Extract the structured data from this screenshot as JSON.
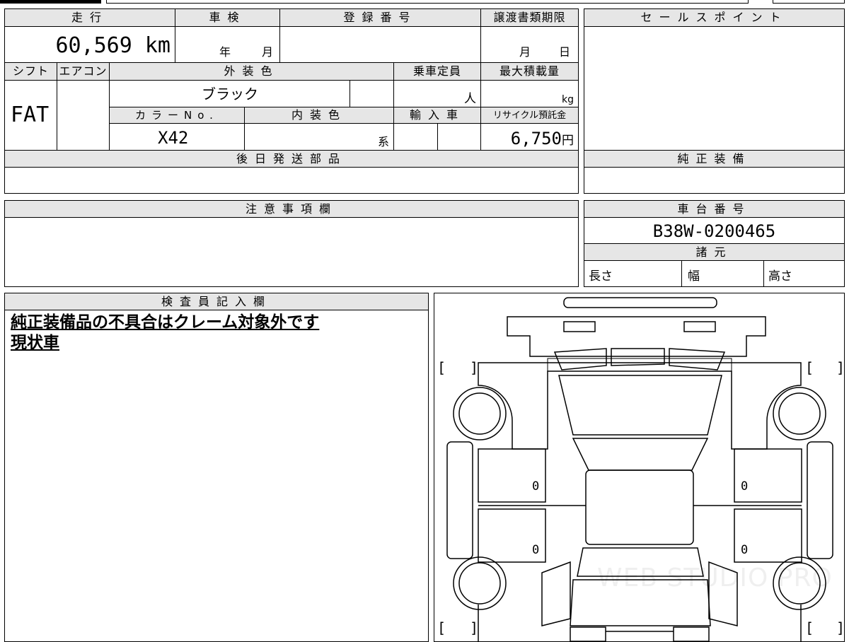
{
  "header": {
    "mileage_label": "走行",
    "shaken_label": "車検",
    "registration_label": "登録番号",
    "transfer_deadline_label": "譲渡書類期限",
    "sales_point_label": "セールスポイント"
  },
  "values": {
    "mileage": "60,569 km",
    "shaken_year_unit": "年",
    "shaken_month_unit": "月",
    "transfer_month_unit": "月",
    "transfer_day_unit": "日"
  },
  "row2": {
    "shift_label": "シフト",
    "aircon_label": "エアコン",
    "exterior_color_label": "外装色",
    "capacity_label": "乗車定員",
    "max_load_label": "最大積載量",
    "shift_value": "FAT",
    "exterior_color_value": "ブラック",
    "capacity_unit": "人",
    "max_load_unit": "kg",
    "color_no_label": "カラーNo.",
    "interior_color_label": "内装色",
    "import_label": "輸入車",
    "recycle_label": "リサイクル預託金",
    "color_no_value": "X42",
    "interior_unit": "系",
    "recycle_value": "6,750",
    "recycle_unit": "円"
  },
  "sections": {
    "later_parts_label": "後日発送部品",
    "genuine_equipment_label": "純正装備",
    "notes_label": "注意事項欄",
    "chassis_label": "車台番号",
    "chassis_value": "B38W-0200465",
    "specs_label": "諸元",
    "length_label": "長さ",
    "width_label": "幅",
    "height_label": "高さ",
    "inspector_label": "検査員記入欄"
  },
  "inspector_notes": [
    "純正装備品の不具合はクレーム対象外です",
    "現状車"
  ],
  "diagram": {
    "zero_marks": [
      "0",
      "0",
      "0",
      "0"
    ],
    "watermark": "WEB STUDIO PRO"
  }
}
